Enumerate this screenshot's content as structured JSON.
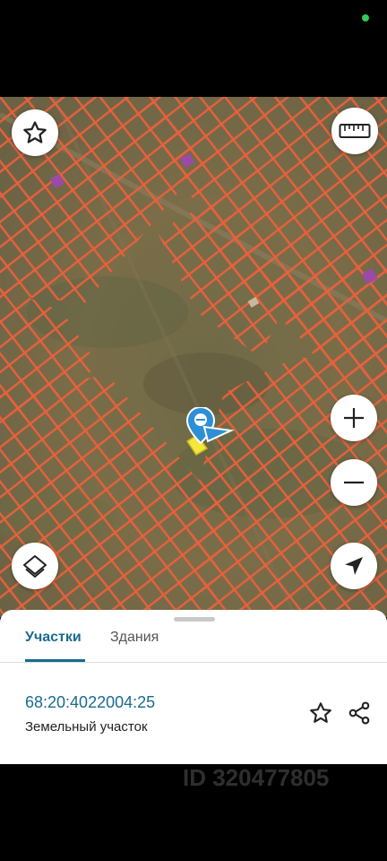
{
  "map": {
    "boundary_color": "#e8603c",
    "selected_plot_color": "#f5e63c",
    "marker_color": "#2d8fd5"
  },
  "controls": {
    "favorite_icon": "star-outline-icon",
    "ruler_icon": "ruler-icon",
    "zoom_in_icon": "plus-icon",
    "zoom_out_icon": "minus-icon",
    "layers_icon": "layers-icon",
    "location_icon": "navigation-arrow-icon"
  },
  "sheet": {
    "tabs": [
      {
        "label": "Участки",
        "active": true
      },
      {
        "label": "Здания",
        "active": false
      }
    ],
    "plot": {
      "cadastral_number": "68:20:4022004:25",
      "type": "Земельный участок"
    },
    "actions": {
      "favorite_icon": "star-outline-icon",
      "share_icon": "share-icon"
    }
  },
  "watermark": "ID 320477805"
}
